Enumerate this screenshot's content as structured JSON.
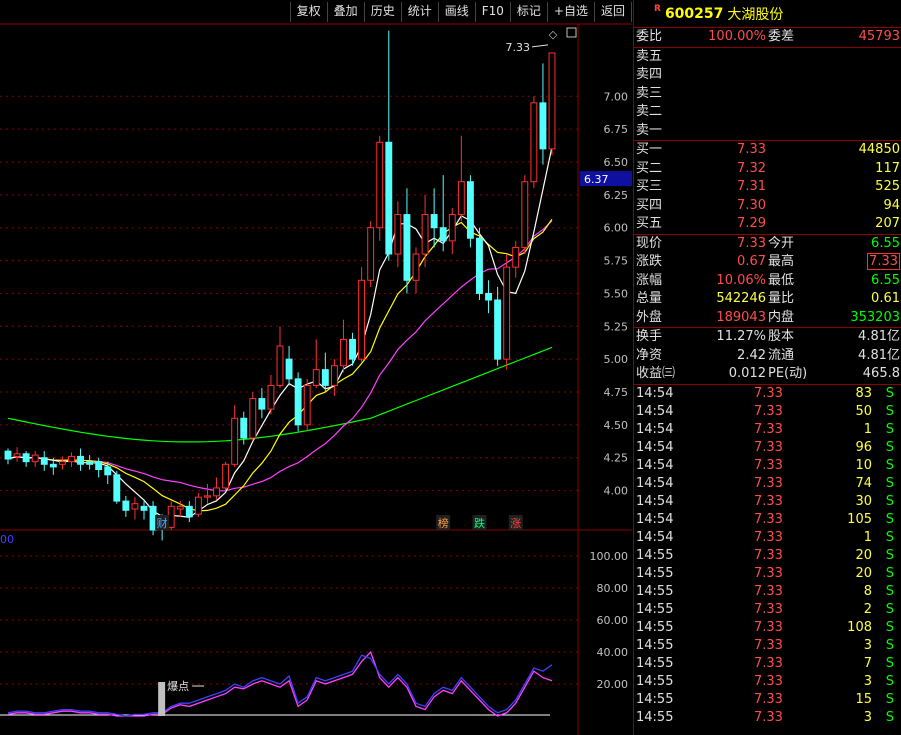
{
  "toolbar": {
    "buttons": [
      "复权",
      "叠加",
      "历史",
      "统计",
      "画线",
      "F10",
      "标记",
      "+自选",
      "返回"
    ]
  },
  "chart_data": {
    "type": "candlestick",
    "y_ticks": [
      "7.00",
      "6.75",
      "6.50",
      "6.25",
      "6.00",
      "5.75",
      "5.50",
      "5.25",
      "5.00",
      "4.75",
      "4.50",
      "4.25",
      "4.00"
    ],
    "ylim": [
      3.7,
      7.55
    ],
    "candles": [
      [
        4.3,
        4.24,
        4.32,
        4.2
      ],
      [
        4.26,
        4.28,
        4.33,
        4.22
      ],
      [
        4.28,
        4.22,
        4.3,
        4.18
      ],
      [
        4.22,
        4.27,
        4.3,
        4.18
      ],
      [
        4.25,
        4.2,
        4.3,
        4.15
      ],
      [
        4.2,
        4.18,
        4.25,
        4.12
      ],
      [
        4.2,
        4.22,
        4.26,
        4.16
      ],
      [
        4.22,
        4.26,
        4.29,
        4.18
      ],
      [
        4.26,
        4.2,
        4.32,
        4.15
      ],
      [
        4.22,
        4.2,
        4.27,
        4.16
      ],
      [
        4.22,
        4.16,
        4.25,
        4.1
      ],
      [
        4.18,
        4.12,
        4.22,
        4.05
      ],
      [
        4.12,
        3.92,
        4.15,
        3.9
      ],
      [
        3.92,
        3.85,
        3.96,
        3.8
      ],
      [
        3.86,
        3.9,
        3.95,
        3.78
      ],
      [
        3.88,
        3.85,
        3.92,
        3.78
      ],
      [
        3.88,
        3.7,
        3.92,
        3.66
      ],
      [
        3.74,
        3.72,
        3.82,
        3.62
      ],
      [
        3.72,
        3.88,
        3.92,
        3.7
      ],
      [
        3.86,
        3.88,
        3.92,
        3.8
      ],
      [
        3.88,
        3.8,
        3.92,
        3.76
      ],
      [
        3.82,
        3.95,
        3.98,
        3.8
      ],
      [
        3.95,
        3.96,
        4.05,
        3.9
      ],
      [
        3.96,
        4.02,
        4.1,
        3.93
      ],
      [
        4.02,
        4.2,
        4.22,
        4.0
      ],
      [
        4.2,
        4.55,
        4.65,
        4.18
      ],
      [
        4.55,
        4.4,
        4.6,
        4.35
      ],
      [
        4.4,
        4.7,
        4.75,
        4.38
      ],
      [
        4.7,
        4.62,
        4.78,
        4.55
      ],
      [
        4.62,
        4.8,
        4.88,
        4.58
      ],
      [
        4.8,
        5.1,
        5.25,
        4.78
      ],
      [
        5.0,
        4.85,
        5.1,
        4.8
      ],
      [
        4.85,
        4.5,
        4.9,
        4.45
      ],
      [
        4.5,
        4.8,
        4.85,
        4.45
      ],
      [
        4.8,
        4.92,
        5.15,
        4.78
      ],
      [
        4.92,
        4.8,
        5.05,
        4.75
      ],
      [
        4.8,
        4.95,
        5.0,
        4.72
      ],
      [
        4.95,
        5.15,
        5.3,
        4.9
      ],
      [
        5.15,
        5.0,
        5.2,
        4.95
      ],
      [
        5.0,
        5.6,
        5.7,
        4.98
      ],
      [
        5.6,
        6.0,
        6.05,
        5.55
      ],
      [
        6.0,
        6.65,
        6.7,
        5.9
      ],
      [
        6.65,
        5.8,
        7.5,
        5.75
      ],
      [
        5.8,
        6.1,
        6.2,
        5.7
      ],
      [
        6.1,
        5.6,
        6.3,
        5.5
      ],
      [
        5.6,
        5.8,
        5.85,
        5.5
      ],
      [
        5.8,
        6.1,
        6.25,
        5.7
      ],
      [
        6.1,
        6.0,
        6.3,
        5.85
      ],
      [
        6.0,
        5.9,
        6.4,
        5.82
      ],
      [
        5.9,
        6.1,
        6.15,
        5.8
      ],
      [
        6.1,
        6.35,
        6.7,
        6.05
      ],
      [
        6.35,
        5.92,
        6.4,
        5.85
      ],
      [
        5.92,
        5.5,
        6.0,
        5.45
      ],
      [
        5.5,
        5.45,
        5.6,
        5.35
      ],
      [
        5.45,
        5.0,
        5.55,
        4.95
      ],
      [
        5.0,
        5.7,
        5.8,
        4.92
      ],
      [
        5.7,
        5.85,
        5.9,
        5.62
      ],
      [
        5.85,
        6.35,
        6.4,
        5.8
      ],
      [
        6.35,
        6.95,
        7.0,
        6.3
      ],
      [
        6.95,
        6.6,
        7.25,
        6.48
      ],
      [
        6.6,
        7.33,
        7.33,
        6.55
      ]
    ],
    "annotations": {
      "high_price": "7.33",
      "current_price": "6.37",
      "events": [
        {
          "label": "财",
          "index": 17,
          "color": "#4da6ff"
        },
        {
          "label": "榜",
          "index": 48,
          "color": "#ffa040"
        },
        {
          "label": "跌",
          "index": 52,
          "color": "#00ff80"
        },
        {
          "label": "涨",
          "index": 56,
          "color": "#ff4040"
        }
      ]
    },
    "indicator": {
      "label_left": "00",
      "y_ticks": [
        "100.00",
        "80.00",
        "60.00",
        "40.00",
        "20.00"
      ],
      "ylim": [
        0,
        110
      ],
      "marker_label": "爆点",
      "marker_index": 17,
      "line_a": [
        2,
        3,
        3,
        2,
        2,
        3,
        4,
        4,
        3,
        3,
        2,
        2,
        1,
        0,
        1,
        1,
        2,
        2,
        6,
        8,
        8,
        10,
        12,
        14,
        16,
        20,
        18,
        22,
        24,
        22,
        20,
        25,
        8,
        12,
        24,
        22,
        24,
        26,
        28,
        38,
        36,
        26,
        20,
        26,
        20,
        8,
        6,
        14,
        18,
        16,
        24,
        18,
        12,
        6,
        2,
        4,
        10,
        20,
        30,
        28,
        32
      ],
      "line_b": [
        1,
        2,
        2,
        1,
        1,
        2,
        3,
        3,
        2,
        2,
        1,
        1,
        0,
        0,
        0,
        0,
        1,
        1,
        5,
        7,
        6,
        8,
        10,
        12,
        14,
        18,
        17,
        20,
        22,
        20,
        18,
        22,
        6,
        10,
        22,
        20,
        22,
        24,
        26,
        34,
        40,
        24,
        18,
        24,
        18,
        6,
        4,
        12,
        16,
        14,
        22,
        16,
        10,
        4,
        0,
        2,
        8,
        18,
        28,
        24,
        22
      ]
    }
  },
  "stock": {
    "r_badge": "R",
    "code": "600257",
    "name": "大湖股份"
  },
  "quote": {
    "wei_bi_label": "委比",
    "wei_bi": "100.00%",
    "wei_cha_label": "委差",
    "wei_cha": "45793",
    "sell": [
      {
        "label": "卖五",
        "price": "",
        "vol": ""
      },
      {
        "label": "卖四",
        "price": "",
        "vol": ""
      },
      {
        "label": "卖三",
        "price": "",
        "vol": ""
      },
      {
        "label": "卖二",
        "price": "",
        "vol": ""
      },
      {
        "label": "卖一",
        "price": "",
        "vol": ""
      }
    ],
    "buy": [
      {
        "label": "买一",
        "price": "7.33",
        "vol": "44850"
      },
      {
        "label": "买二",
        "price": "7.32",
        "vol": "117"
      },
      {
        "label": "买三",
        "price": "7.31",
        "vol": "525"
      },
      {
        "label": "买四",
        "price": "7.30",
        "vol": "94"
      },
      {
        "label": "买五",
        "price": "7.29",
        "vol": "207"
      }
    ],
    "stats_a": [
      {
        "l1": "现价",
        "v1": "7.33",
        "c1": "red",
        "l2": "今开",
        "v2": "6.55",
        "c2": "grn",
        "box": false
      },
      {
        "l1": "涨跌",
        "v1": "0.67",
        "c1": "red",
        "l2": "最高",
        "v2": "7.33",
        "c2": "red",
        "box": true
      },
      {
        "l1": "涨幅",
        "v1": "10.06%",
        "c1": "red",
        "l2": "最低",
        "v2": "6.55",
        "c2": "grn",
        "box": false
      },
      {
        "l1": "总量",
        "v1": "542246",
        "c1": "yel",
        "l2": "量比",
        "v2": "0.61",
        "c2": "yel",
        "box": false
      },
      {
        "l1": "外盘",
        "v1": "189043",
        "c1": "red",
        "l2": "内盘",
        "v2": "353203",
        "c2": "grn",
        "box": false
      }
    ],
    "stats_b": [
      {
        "l1": "换手",
        "v1": "11.27%",
        "l2": "股本",
        "v2": "4.81亿"
      },
      {
        "l1": "净资",
        "v1": "2.42",
        "l2": "流通",
        "v2": "4.81亿"
      },
      {
        "l1": "收益㈢",
        "v1": "0.012",
        "l2": "PE(动)",
        "v2": "465.8"
      }
    ]
  },
  "ticks": [
    {
      "time": "14:54",
      "price": "7.33",
      "vol": "83",
      "side": "S"
    },
    {
      "time": "14:54",
      "price": "7.33",
      "vol": "50",
      "side": "S"
    },
    {
      "time": "14:54",
      "price": "7.33",
      "vol": "1",
      "side": "S"
    },
    {
      "time": "14:54",
      "price": "7.33",
      "vol": "96",
      "side": "S"
    },
    {
      "time": "14:54",
      "price": "7.33",
      "vol": "10",
      "side": "S"
    },
    {
      "time": "14:54",
      "price": "7.33",
      "vol": "74",
      "side": "S"
    },
    {
      "time": "14:54",
      "price": "7.33",
      "vol": "30",
      "side": "S"
    },
    {
      "time": "14:54",
      "price": "7.33",
      "vol": "105",
      "side": "S"
    },
    {
      "time": "14:54",
      "price": "7.33",
      "vol": "1",
      "side": "S"
    },
    {
      "time": "14:55",
      "price": "7.33",
      "vol": "20",
      "side": "S"
    },
    {
      "time": "14:55",
      "price": "7.33",
      "vol": "20",
      "side": "S"
    },
    {
      "time": "14:55",
      "price": "7.33",
      "vol": "8",
      "side": "S"
    },
    {
      "time": "14:55",
      "price": "7.33",
      "vol": "2",
      "side": "S"
    },
    {
      "time": "14:55",
      "price": "7.33",
      "vol": "108",
      "side": "S"
    },
    {
      "time": "14:55",
      "price": "7.33",
      "vol": "3",
      "side": "S"
    },
    {
      "time": "14:55",
      "price": "7.33",
      "vol": "7",
      "side": "S"
    },
    {
      "time": "14:55",
      "price": "7.33",
      "vol": "3",
      "side": "S"
    },
    {
      "time": "14:55",
      "price": "7.33",
      "vol": "15",
      "side": "S"
    },
    {
      "time": "14:55",
      "price": "7.33",
      "vol": "3",
      "side": "S"
    }
  ],
  "colors": {
    "up": "#ff3030",
    "down": "#54ffff",
    "ma5": "#ffffff",
    "ma10": "#ffff00",
    "ma20": "#ff40ff",
    "ma60": "#00ff00",
    "grid": "#8b0000"
  }
}
